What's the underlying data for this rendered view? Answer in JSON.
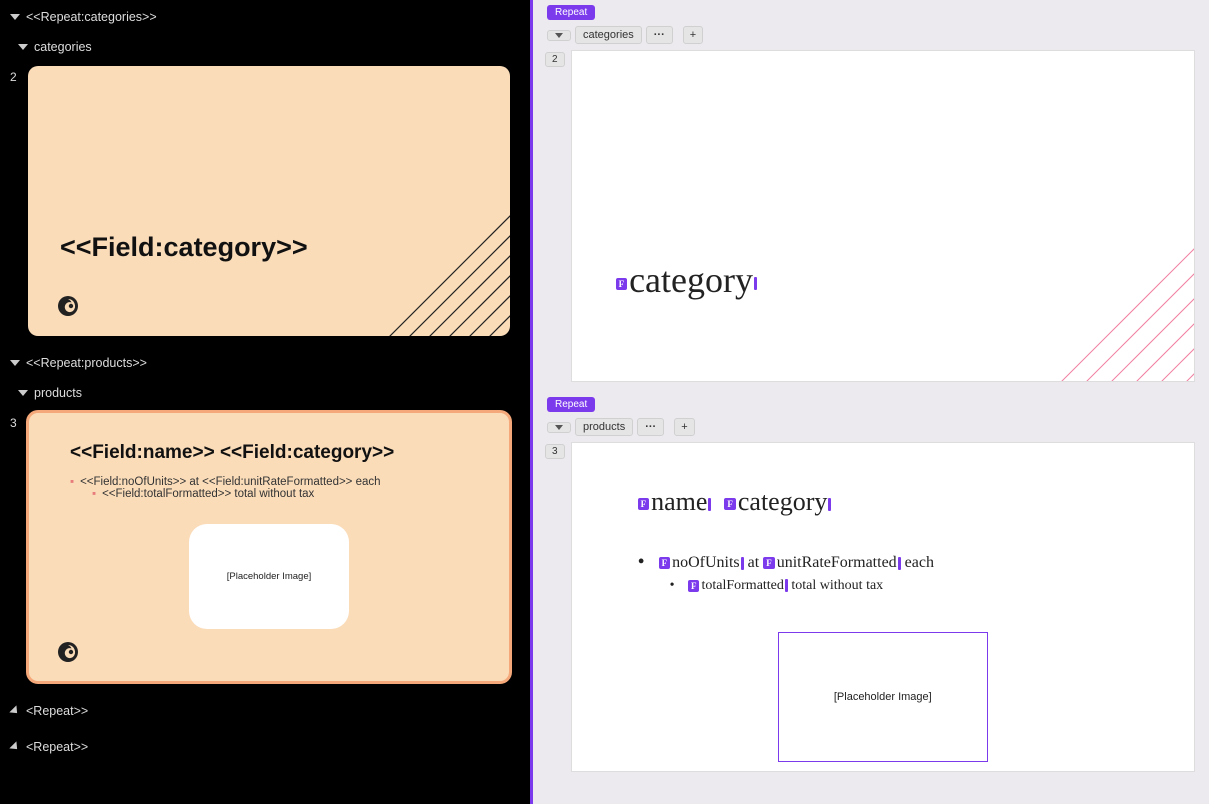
{
  "tree": {
    "repeat_categories": "<<Repeat:categories>>",
    "categories_label": "categories",
    "repeat_products": "<<Repeat:products>>",
    "products_label": "products",
    "end_repeat_1": "<Repeat>>",
    "end_repeat_2": "<Repeat>>"
  },
  "slides": {
    "s1": {
      "num": "2",
      "title": "<<Field:category>>"
    },
    "s2": {
      "num": "3",
      "title": "<<Field:name>> <<Field:category>>",
      "bullet1": "<<Field:noOfUnits>> at <<Field:unitRateFormatted>> each",
      "bullet2": "<<Field:totalFormatted>> total without tax",
      "placeholder": "[Placeholder Image]"
    }
  },
  "right": {
    "repeat_label": "Repeat",
    "field_tag": "F",
    "plus": "+",
    "dots": "···",
    "block1": {
      "tag": "categories",
      "num": "2",
      "field1": "category"
    },
    "block2": {
      "tag": "products",
      "num": "3",
      "f_name": "name",
      "f_category": "category",
      "f_units": "noOfUnits",
      "txt_at": " at ",
      "f_rate": "unitRateFormatted",
      "txt_each": " each",
      "f_total": "totalFormatted",
      "txt_total": " total without tax",
      "placeholder": "[Placeholder Image]"
    }
  }
}
